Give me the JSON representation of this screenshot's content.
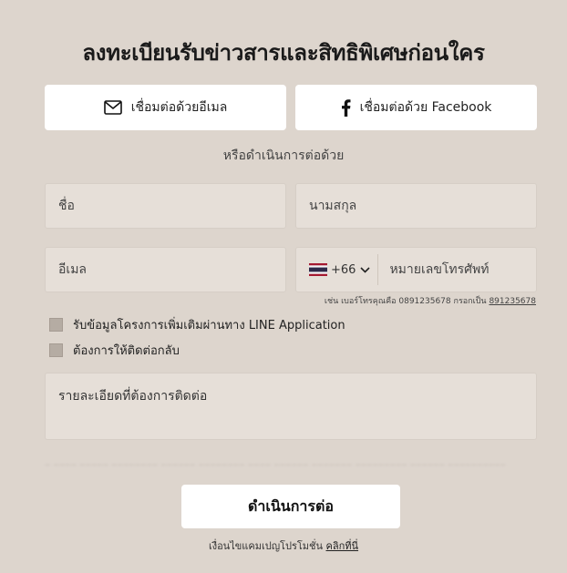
{
  "title": "ลงทะเบียนรับข่าวสารและสิทธิพิเศษก่อนใคร",
  "social": {
    "email_label": "เชื่อมต่อด้วยอีเมล",
    "email_icon": "mail-icon",
    "facebook_label": "เชื่อมต่อด้วย Facebook",
    "facebook_icon": "facebook-icon"
  },
  "or_text": "หรือดำเนินการต่อด้วย",
  "form": {
    "firstname_placeholder": "ชื่อ",
    "lastname_placeholder": "นามสกุล",
    "email_placeholder": "อีเมล",
    "country_code": "+66",
    "country_flag": "thailand-flag-icon",
    "phone_placeholder": "หมายเลขโทรศัพท์",
    "phone_hint": "เช่น เบอร์โทรคุณคือ 0891235678 กรอกเป็น",
    "phone_hint_example": "891235678",
    "checkbox_line": "รับข้อมูลโครงการเพิ่มเติมผ่านทาง LINE Application",
    "checkbox_callback": "ต้องการให้ติดต่อกลับ",
    "details_placeholder": "รายละเอียดที่ต้องการติดต่อ"
  },
  "submit_label": "ดำเนินการต่อ",
  "footer": {
    "text": "เงื่อนไขแคมเปญโปรโมชั่น",
    "link": "คลิกที่นี่"
  },
  "colors": {
    "background": "#ddd5cd",
    "field": "#e6dfd8",
    "button": "#ffffff",
    "checkbox": "#b5aca3"
  }
}
